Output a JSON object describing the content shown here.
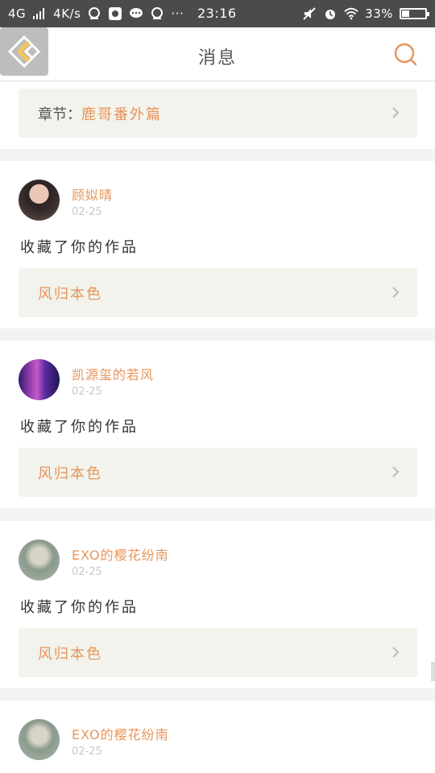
{
  "status_bar": {
    "network": "4G",
    "signal_icon": "signal-bars-icon",
    "speed": "4K/s",
    "time": "23:16",
    "battery": "33%",
    "battery_level": 0.33
  },
  "header": {
    "title": "消息",
    "back_icon": "back-arrow-icon",
    "search_icon": "search-icon"
  },
  "top_card": {
    "label": "章节：",
    "value": "鹿哥番外篇"
  },
  "messages": [
    {
      "user": "顾姒晴",
      "date": "02-25",
      "action": "收藏了你的作品",
      "work": "风归本色"
    },
    {
      "user": "凯源玺的若风",
      "date": "02-25",
      "action": "收藏了你的作品",
      "work": "风归本色"
    },
    {
      "user": "EXO的樱花纷南",
      "date": "02-25",
      "action": "收藏了你的作品",
      "work": "风归本色"
    },
    {
      "user": "EXO的樱花纷南",
      "date": "02-25"
    }
  ],
  "colors": {
    "accent": "#e8955a",
    "card_bg": "#f2f3ec",
    "status_bar_bg": "#4b4b4b"
  }
}
